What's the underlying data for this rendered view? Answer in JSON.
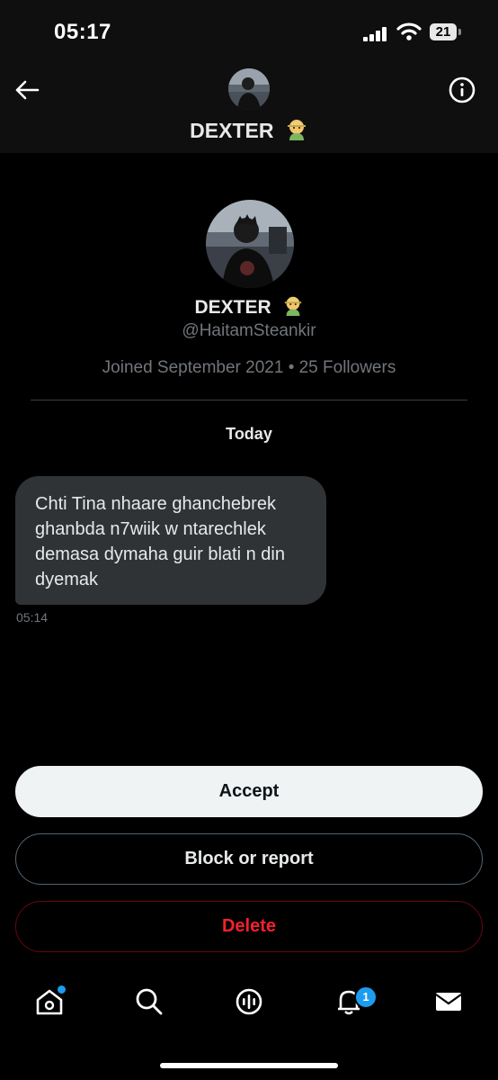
{
  "status_bar": {
    "time": "05:17",
    "battery": "21"
  },
  "header": {
    "name": "DEXTER",
    "emoji": "farmer-emoji"
  },
  "profile": {
    "name": "DEXTER",
    "handle": "@HaitamSteankir",
    "meta": "Joined September 2021 • 25 Followers"
  },
  "conversation": {
    "date_label": "Today",
    "messages": [
      {
        "text": "Chti Tina nhaare ghanchebrek ghanbda n7wiik w ntarechlek demasa dymaha guir blati n din dyemak",
        "time": "05:14"
      }
    ]
  },
  "actions": {
    "accept": "Accept",
    "block": "Block or report",
    "delete": "Delete"
  },
  "nav": {
    "notification_count": "1",
    "icons": [
      "home-icon",
      "search-icon",
      "spaces-icon",
      "notifications-icon",
      "messages-icon"
    ]
  },
  "colors": {
    "accent": "#1d9bf0",
    "delete": "#f4212e",
    "bubble": "#2f3336"
  }
}
